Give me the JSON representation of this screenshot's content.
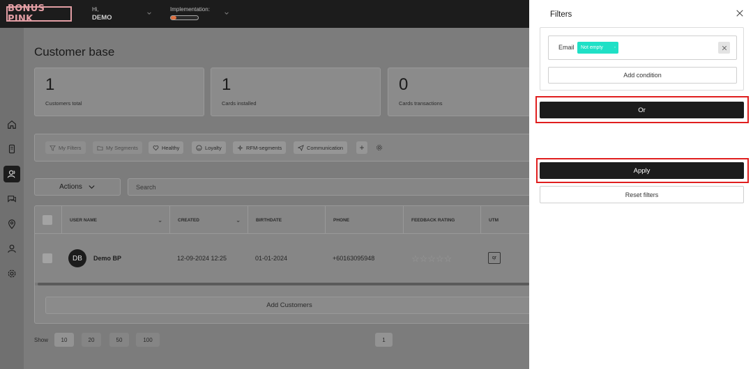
{
  "header": {
    "logo": "BONUS PINK",
    "greeting": "Hi,",
    "user_name": "DEMO",
    "implementation_label": "Implementation:",
    "implementation_progress": 0.2
  },
  "sidebar": {
    "items": [
      {
        "name": "home-icon"
      },
      {
        "name": "mobile-card-icon"
      },
      {
        "name": "customers-icon",
        "active": true
      },
      {
        "name": "chat-icon"
      },
      {
        "name": "location-icon"
      },
      {
        "name": "user-icon"
      },
      {
        "name": "settings-icon"
      }
    ]
  },
  "main": {
    "title": "Customer base",
    "stats": [
      {
        "value": "1",
        "label": "Customers total"
      },
      {
        "value": "1",
        "label": "Cards installed"
      },
      {
        "value": "0",
        "label": "Cards transactions"
      }
    ],
    "filter_chips": [
      {
        "label": "My Filters",
        "icon": "filter-icon"
      },
      {
        "label": "My Segments",
        "icon": "folder-icon"
      },
      {
        "label": "Healthy",
        "icon": "heart-icon"
      },
      {
        "label": "Loyalty",
        "icon": "smile-icon"
      },
      {
        "label": "RFM-segments",
        "icon": "rfm-icon"
      },
      {
        "label": "Communication",
        "icon": "send-icon"
      }
    ],
    "actions_label": "Actions",
    "search_placeholder": "Search",
    "table": {
      "columns": [
        "USER NAME",
        "CREATED",
        "BIRTHDATE",
        "PHONE",
        "FEEDBACK RATING",
        "UTM"
      ],
      "rows": [
        {
          "initials": "DB",
          "name": "Demo BP",
          "created": "12-09-2024 12:25",
          "birthdate": "01-01-2024",
          "phone": "+60163095948",
          "rating": 0,
          "utm": "qr"
        }
      ],
      "add_button": "Add Customers"
    },
    "pagination": {
      "show_label": "Show",
      "sizes": [
        "10",
        "20",
        "50",
        "100"
      ],
      "current_page": "1"
    }
  },
  "filters_panel": {
    "title": "Filters",
    "condition": {
      "field": "Email",
      "operator": "Not empty"
    },
    "add_condition": "Add condition",
    "or_button": "Or",
    "apply_button": "Apply",
    "reset_button": "Reset filters",
    "highlight_color": "#e01e1e",
    "tag_color": "#1fe0c6"
  }
}
